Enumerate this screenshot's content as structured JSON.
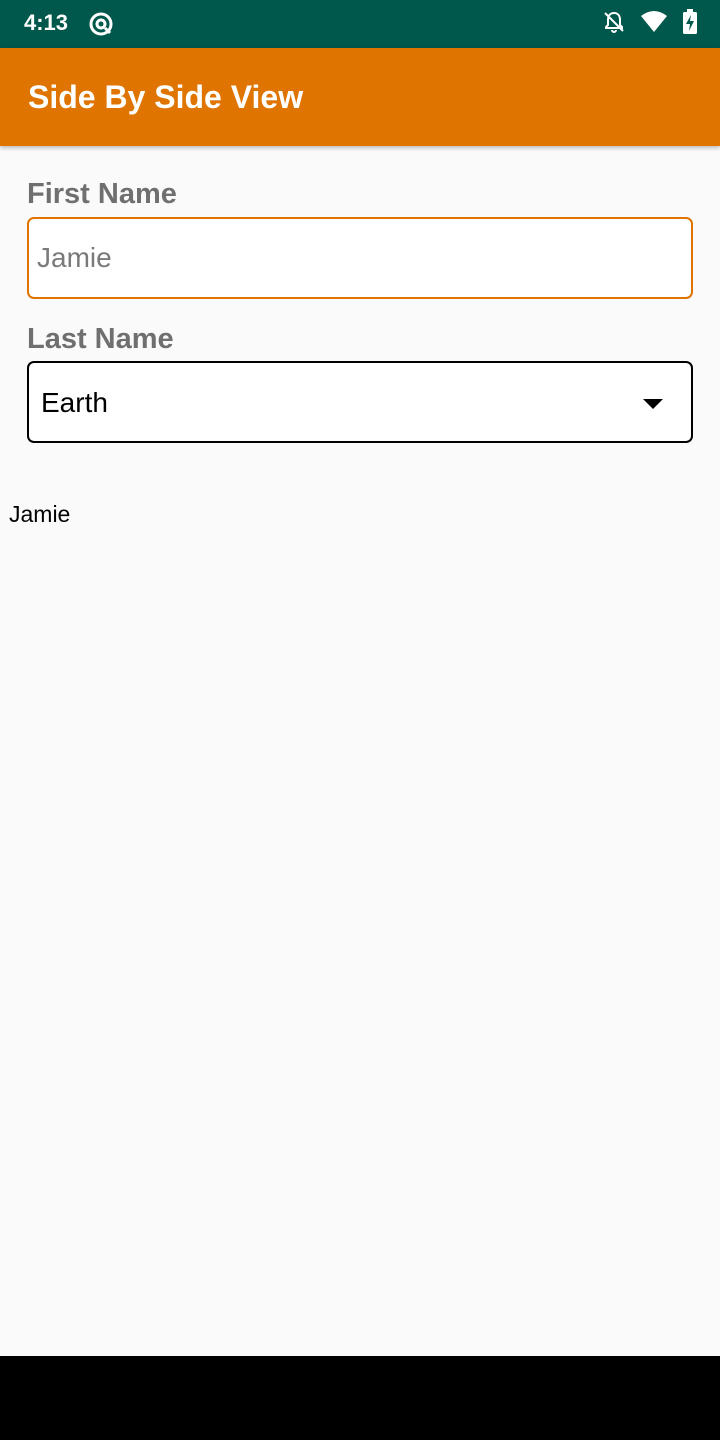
{
  "status_bar": {
    "time": "4:13",
    "icons": [
      "sync-icon",
      "notifications-off-icon",
      "wifi-icon",
      "battery-charging-icon"
    ],
    "background": "#00574b"
  },
  "app_bar": {
    "title": "Side By Side View",
    "background": "#e07400"
  },
  "form": {
    "first_name_label": "First Name",
    "first_name_value": "Jamie",
    "last_name_label": "Last Name",
    "last_name_selected": "Earth"
  },
  "output": {
    "text": "Jamie"
  },
  "colors": {
    "accent": "#e07400",
    "label": "#6f6f6f",
    "page_background": "#fafafa"
  }
}
